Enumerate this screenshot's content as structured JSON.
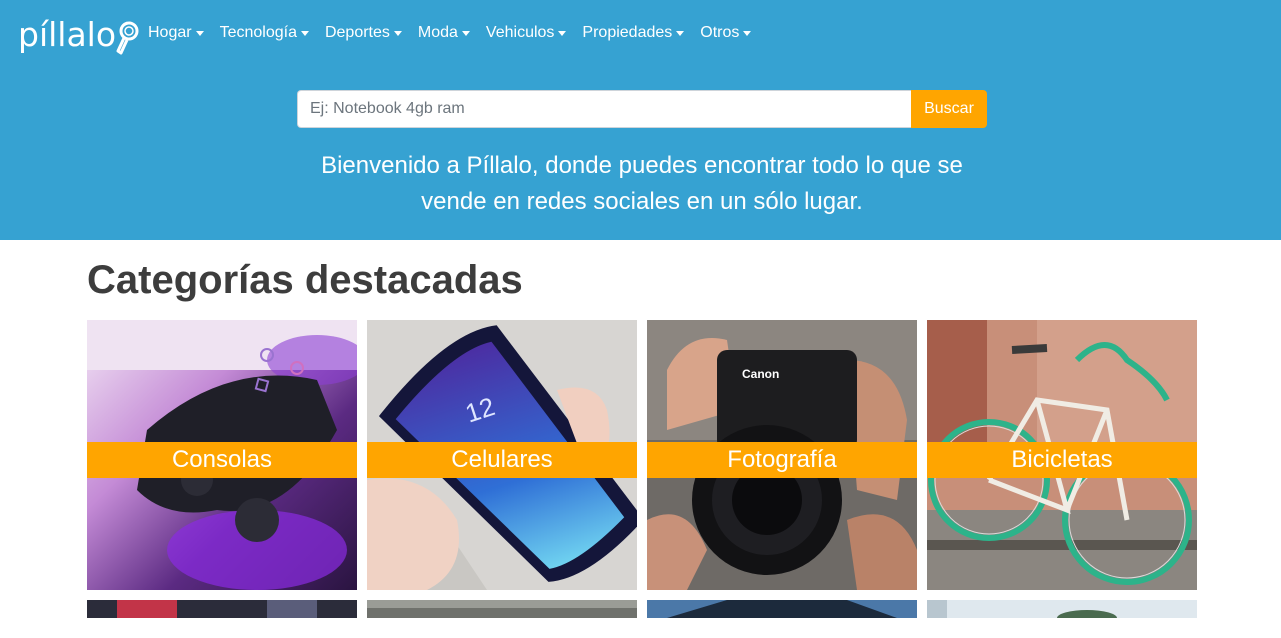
{
  "brand": {
    "name": "píllalo"
  },
  "nav": {
    "items": [
      {
        "label": "Hogar"
      },
      {
        "label": "Tecnología"
      },
      {
        "label": "Deportes"
      },
      {
        "label": "Moda"
      },
      {
        "label": "Vehiculos"
      },
      {
        "label": "Propiedades"
      },
      {
        "label": "Otros"
      }
    ]
  },
  "search": {
    "placeholder": "Ej: Notebook 4gb ram",
    "value": "",
    "button_label": "Buscar"
  },
  "hero": {
    "welcome": "Bienvenido a Píllalo, donde puedes encontrar todo lo que se vende en redes sociales en un sólo lugar."
  },
  "featured": {
    "title": "Categorías destacadas",
    "categories": [
      {
        "label": "Consolas"
      },
      {
        "label": "Celulares"
      },
      {
        "label": "Fotografía"
      },
      {
        "label": "Bicicletas"
      }
    ]
  },
  "colors": {
    "hero_bg": "#36a2d2",
    "accent": "#ffa500",
    "title_text": "#3d3d3d"
  }
}
